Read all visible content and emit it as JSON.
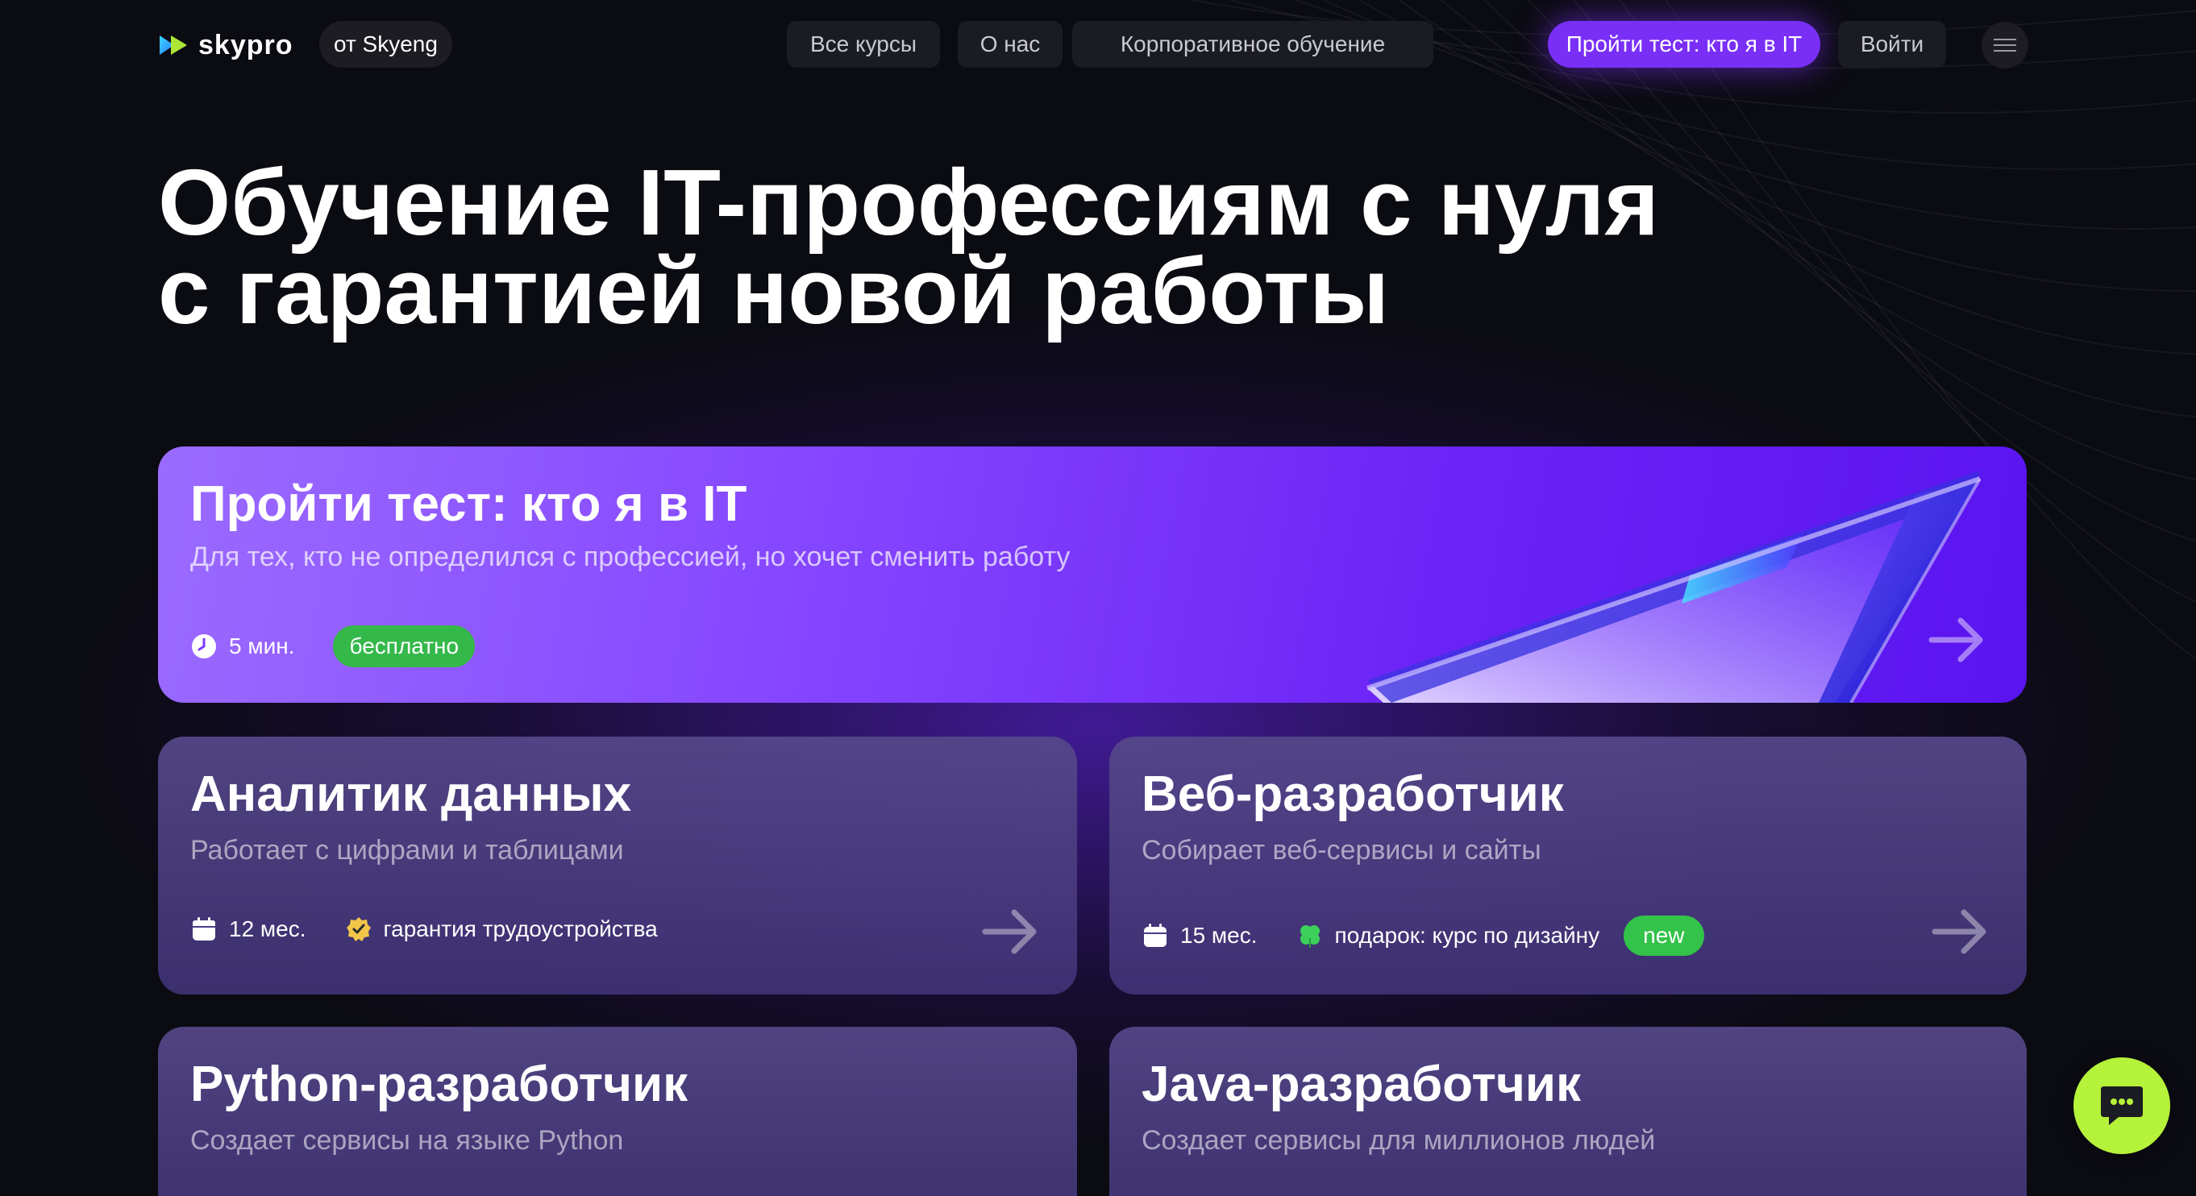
{
  "header": {
    "logo_text": "skypro",
    "from_label": "от Skyeng",
    "nav": {
      "courses": "Все курсы",
      "about": "О нас",
      "corporate": "Корпоративное обучение"
    },
    "test_button": "Пройти тест: кто я в IT",
    "login_button": "Войти"
  },
  "hero": {
    "line1": "Обучение IT-профессиям с нуля",
    "line2": "с гарантией новой работы"
  },
  "test_card": {
    "title": "Пройти тест: кто я в IT",
    "subtitle": "Для тех, кто не определился с профессией, но хочет сменить работу",
    "duration": "5 мин.",
    "badge": "бесплатно"
  },
  "courses": [
    {
      "title": "Аналитик данных",
      "subtitle": "Работает с цифрами и таблицами",
      "duration": "12 мес.",
      "perk": "гарантия трудоустройства"
    },
    {
      "title": "Веб-разработчик",
      "subtitle": "Собирает веб-сервисы и сайты",
      "duration": "15 мес.",
      "perk": "подарок: курс по дизайну",
      "badge": "new"
    },
    {
      "title": "Python-разработчик",
      "subtitle": "Создает сервисы на языке Python"
    },
    {
      "title": "Java-разработчик",
      "subtitle": "Создает сервисы для миллионов людей"
    }
  ],
  "colors": {
    "accent": "#7a2ff7",
    "badge_green": "#35b84a",
    "chat_button": "#b5f23a",
    "background": "#0b0b12"
  },
  "icons": {
    "logo": "play-logo-icon",
    "menu": "hamburger-menu-icon",
    "clock": "clock-icon",
    "calendar": "calendar-icon",
    "guarantee": "guarantee-badge-icon",
    "gift": "clover-gift-icon",
    "arrow": "arrow-right-icon",
    "chat": "chat-icon"
  }
}
